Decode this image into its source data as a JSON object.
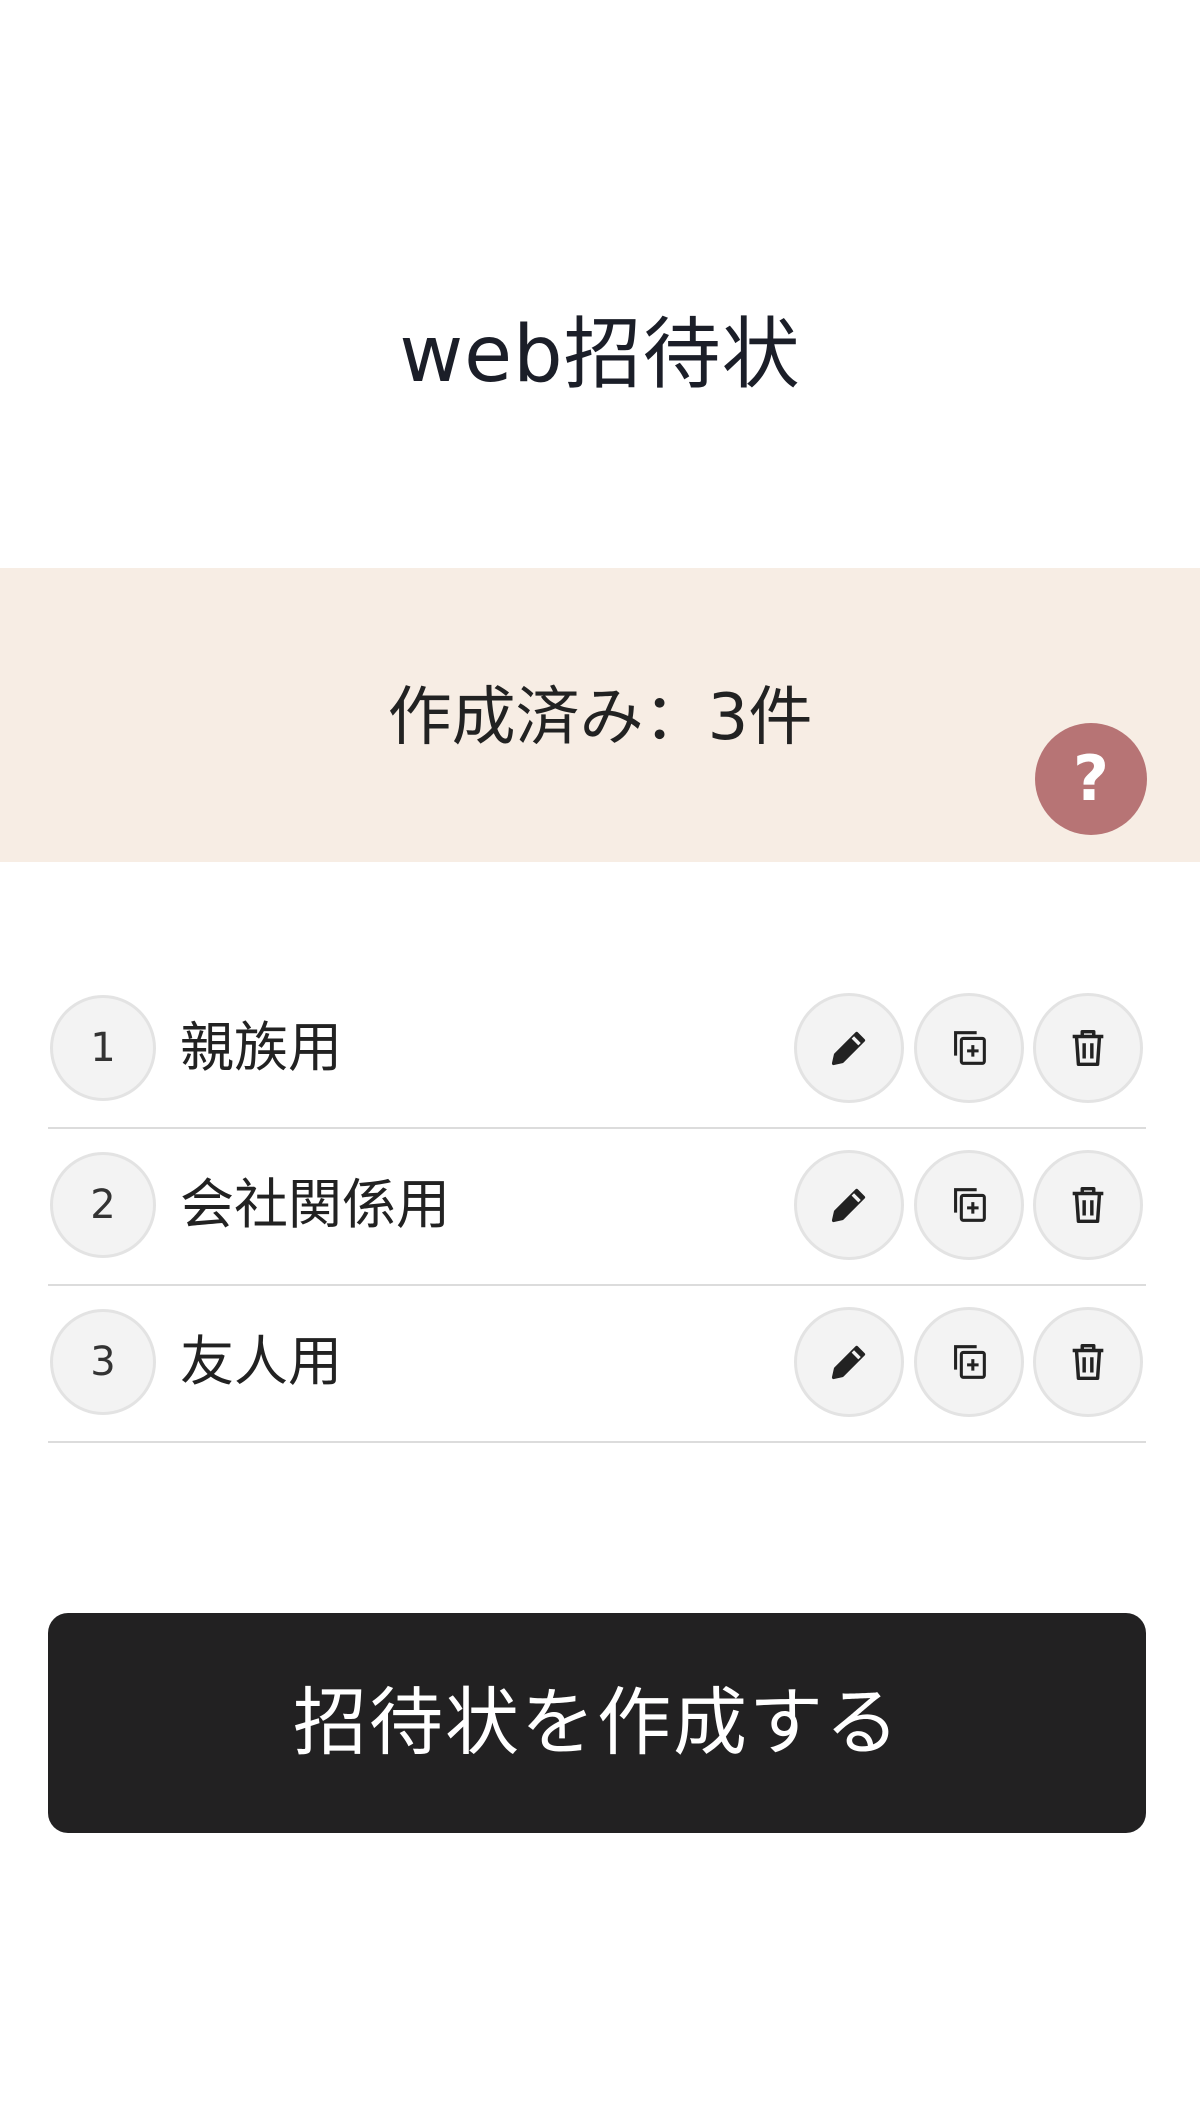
{
  "header": {
    "title": "web招待状"
  },
  "summary": {
    "count_label": "作成済み：3件",
    "help_label": "?"
  },
  "invitations": [
    {
      "number": "1",
      "name": "親族用"
    },
    {
      "number": "2",
      "name": "会社関係用"
    },
    {
      "number": "3",
      "name": "友人用"
    }
  ],
  "actions": {
    "create_label": "招待状を作成する"
  },
  "colors": {
    "banner": "#f7ede4",
    "help": "#b77475",
    "primary_button": "#222122"
  }
}
